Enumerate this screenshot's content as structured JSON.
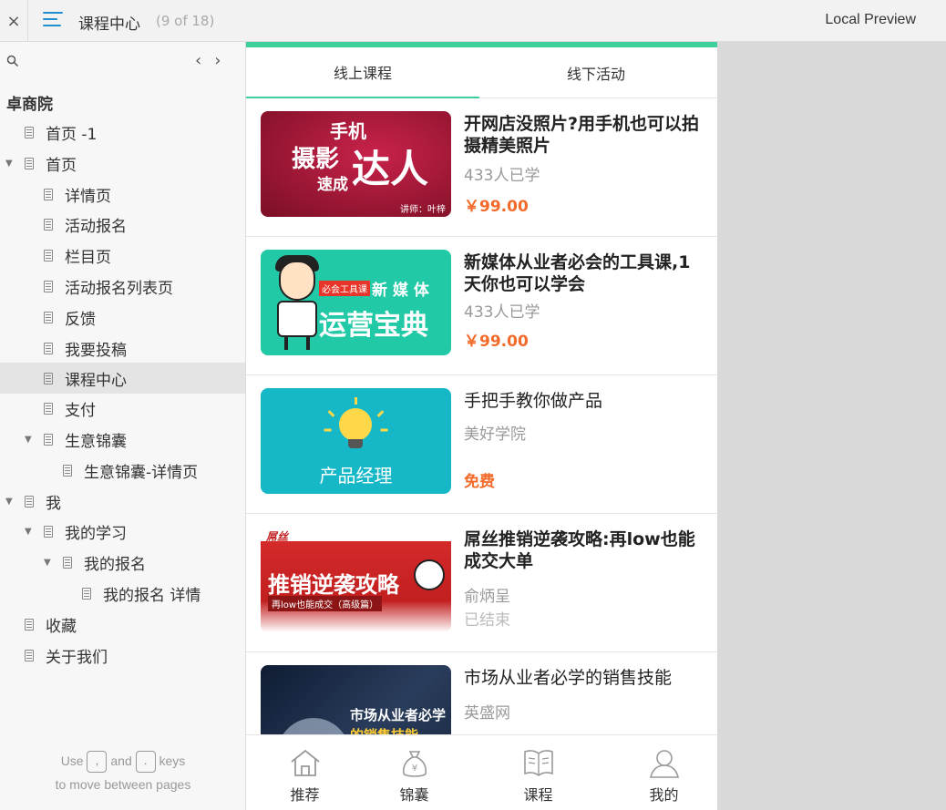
{
  "topbar": {
    "close": "×",
    "title": "课程中心",
    "pages": "(9 of 18)",
    "preview": "Local Preview"
  },
  "sidebar": {
    "root": "卓商院",
    "items": [
      {
        "label": "首页 -1"
      },
      {
        "label": "首页"
      },
      {
        "label": "详情页"
      },
      {
        "label": "活动报名"
      },
      {
        "label": "栏目页"
      },
      {
        "label": "活动报名列表页"
      },
      {
        "label": "反馈"
      },
      {
        "label": "我要投稿"
      },
      {
        "label": "课程中心"
      },
      {
        "label": "支付"
      },
      {
        "label": "生意锦囊"
      },
      {
        "label": "生意锦囊-详情页"
      },
      {
        "label": "我"
      },
      {
        "label": "我的学习"
      },
      {
        "label": "我的报名"
      },
      {
        "label": "我的报名 详情"
      },
      {
        "label": "收藏"
      },
      {
        "label": "关于我们"
      }
    ],
    "help_use": "Use",
    "help_and": "and",
    "help_keys": "keys",
    "help_line2": "to move between pages",
    "key_prev": ",",
    "key_next": "."
  },
  "tabs": [
    "线上课程",
    "线下活动"
  ],
  "courses": [
    {
      "title": "开网店没照片?用手机也可以拍摄精美照片",
      "meta": "433人已学",
      "price": "￥99.00",
      "thumb": {
        "a": "手机",
        "b": "摄影",
        "c": "达人",
        "d": "速成",
        "e": "讲师：叶梓"
      }
    },
    {
      "title": "新媒体从业者必会的工具课,1天你也可以学会",
      "meta": "433人已学",
      "price": "￥99.00",
      "thumb": {
        "tag": "必会工具课",
        "nm": "新 媒 体",
        "big": "运营宝典"
      }
    },
    {
      "title": "手把手教你做产品",
      "meta": "美好学院",
      "price": "免费",
      "thumb": {
        "lbl": "产品经理"
      }
    },
    {
      "title": "屌丝推销逆袭攻略:再low也能成交大单",
      "meta": "俞炳呈",
      "price": "已结束",
      "thumb": {
        "a": "屌丝",
        "b": "推销逆袭攻略",
        "c": "再low也能成交（高级篇）"
      }
    },
    {
      "title": "市场从业者必学的销售技能",
      "meta": "英盛网",
      "thumb": {
        "a": "市场从业者必学",
        "b": "的销售技能"
      }
    }
  ],
  "bottom_nav": [
    {
      "label": "推荐",
      "icon": "home-icon"
    },
    {
      "label": "锦囊",
      "icon": "money-bag-icon"
    },
    {
      "label": "课程",
      "icon": "book-icon"
    },
    {
      "label": "我的",
      "icon": "user-icon"
    }
  ],
  "colors": {
    "accent": "#3ecf9a",
    "price": "#f26b2a",
    "menu_icon": "#1f8fd0"
  }
}
